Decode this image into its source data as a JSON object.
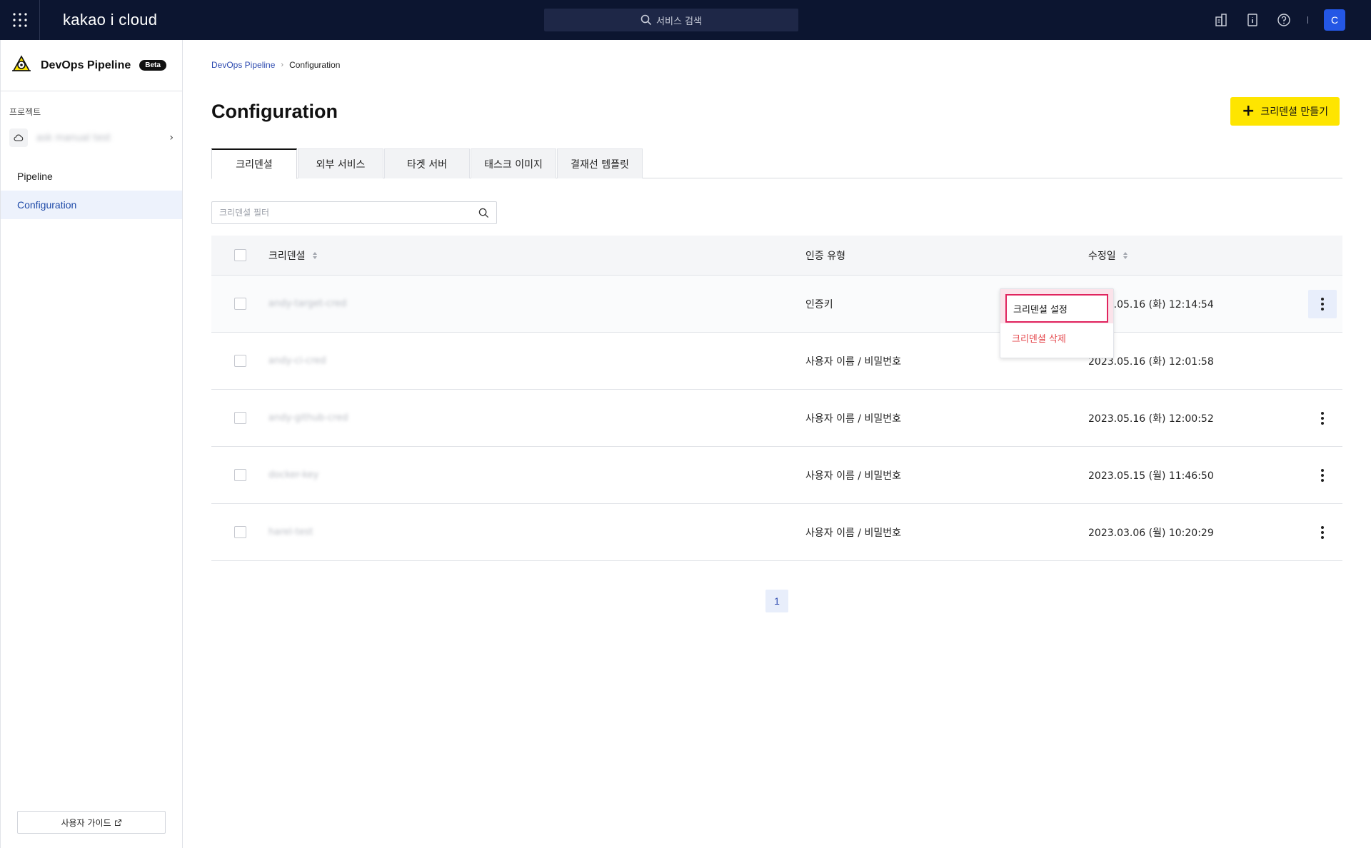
{
  "topbar": {
    "logo": "kakao i cloud",
    "search_label": "서비스 검색",
    "avatar_letter": "C",
    "icons": [
      "grid-icon",
      "building-icon",
      "document-icon",
      "help-icon"
    ]
  },
  "sidebar": {
    "service_title": "DevOps Pipeline",
    "beta_badge": "Beta",
    "project_label": "프로젝트",
    "project_name": "ask manual test",
    "nav": [
      {
        "label": "Pipeline",
        "active": false
      },
      {
        "label": "Configuration",
        "active": true
      }
    ],
    "guide_label": "사용자 가이드"
  },
  "breadcrumb": {
    "root": "DevOps Pipeline",
    "current": "Configuration"
  },
  "page": {
    "title": "Configuration",
    "create_button": "크리덴셜 만들기"
  },
  "tabs": [
    "크리덴셜",
    "외부 서비스",
    "타겟 서버",
    "태스크 이미지",
    "결재선 템플릿"
  ],
  "filter": {
    "placeholder": "크리덴셜 필터"
  },
  "table": {
    "columns": {
      "name": "크리덴셜",
      "type": "인증 유형",
      "date": "수정일"
    },
    "rows": [
      {
        "name": "andy-target-cred",
        "type": "인증키",
        "date": "2023.05.16 (화) 12:14:54"
      },
      {
        "name": "andy-ci-cred",
        "type": "사용자 이름 / 비밀번호",
        "date": "2023.05.16 (화) 12:01:58"
      },
      {
        "name": "andy-github-cred",
        "type": "사용자 이름 / 비밀번호",
        "date": "2023.05.16 (화) 12:00:52"
      },
      {
        "name": "docker-key",
        "type": "사용자 이름 / 비밀번호",
        "date": "2023.05.15 (월) 11:46:50"
      },
      {
        "name": "harel-test",
        "type": "사용자 이름 / 비밀번호",
        "date": "2023.03.06 (월) 10:20:29"
      }
    ]
  },
  "context_menu": {
    "settings": "크리덴셜 설정",
    "delete": "크리덴셜 삭제"
  },
  "pagination": {
    "current": "1"
  },
  "colors": {
    "topbar_bg": "#0c1530",
    "primary_button": "#fee500",
    "accent_blue": "#2e4bb0",
    "danger": "#e5484d",
    "highlight": "#e0245e"
  }
}
